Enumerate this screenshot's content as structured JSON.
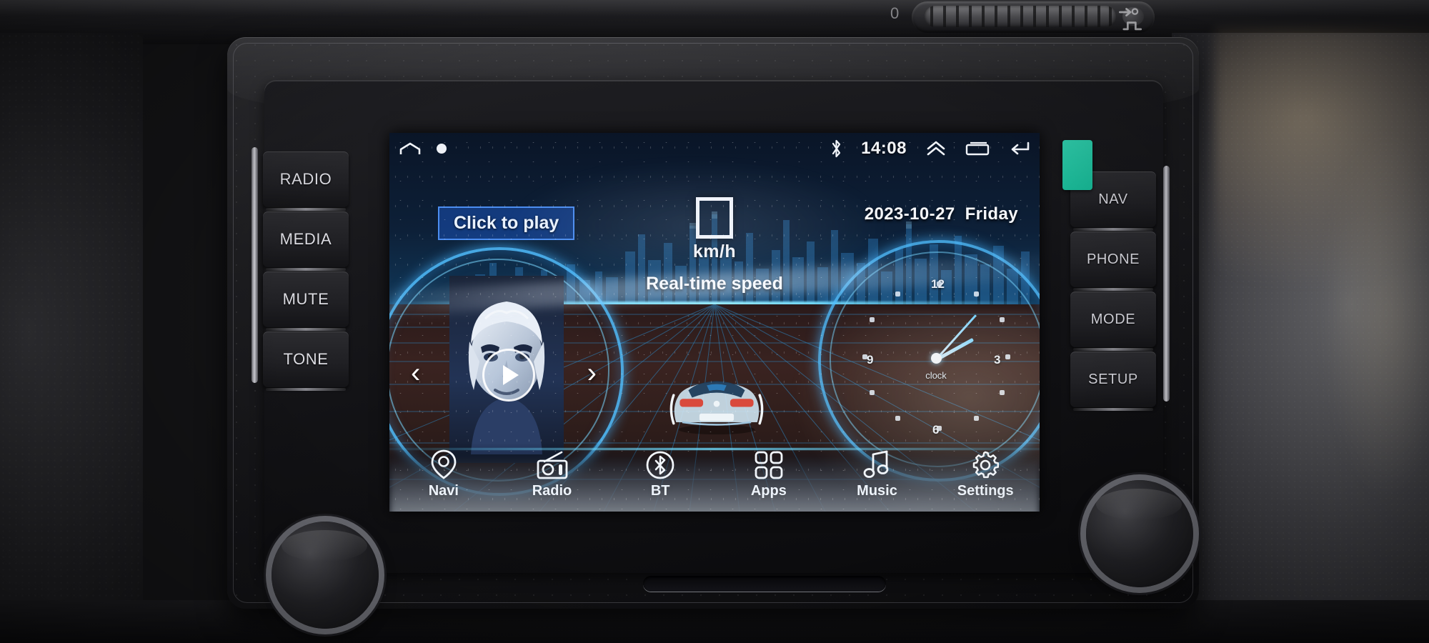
{
  "device": {
    "name": "car-head-unit",
    "brand_context": "Volkswagen RCD-style android car stereo"
  },
  "hard_buttons_left": [
    {
      "label": "RADIO",
      "name": "radio-button"
    },
    {
      "label": "MEDIA",
      "name": "media-button"
    },
    {
      "label": "MUTE",
      "name": "mute-button"
    },
    {
      "label": "TONE",
      "name": "tone-button"
    }
  ],
  "hard_buttons_right": [
    {
      "label": "NAV",
      "name": "nav-button"
    },
    {
      "label": "PHONE",
      "name": "phone-button"
    },
    {
      "label": "MODE",
      "name": "mode-button"
    },
    {
      "label": "SETUP",
      "name": "setup-button"
    }
  ],
  "status_bar": {
    "home_icon": "home-icon",
    "indicator_dot": "recording-dot-icon",
    "bluetooth_icon": "bluetooth-icon",
    "time": "14:08",
    "expand_icon": "double-chevron-up-icon",
    "recents_icon": "recents-square-icon",
    "back_icon": "back-arrow-icon"
  },
  "media_widget": {
    "play_prompt": "Click to play",
    "play_icon": "play-triangle-icon",
    "prev_icon": "chevron-left-icon",
    "next_icon": "chevron-right-icon",
    "album_art": "anime-character-album-art"
  },
  "speed_widget": {
    "value": "",
    "unit": "km/h",
    "label": "Real-time speed",
    "box_icon": "speed-value-placeholder"
  },
  "date_widget": {
    "date": "2023-10-27",
    "weekday": "Friday"
  },
  "clock_widget": {
    "label": "clock",
    "numerals": [
      "12",
      "3",
      "6",
      "9"
    ],
    "hour_angle_deg": 61,
    "minute_angle_deg": 48
  },
  "dock": [
    {
      "label": "Navi",
      "icon": "location-pin-icon",
      "name": "dock-item-navi"
    },
    {
      "label": "Radio",
      "icon": "radio-icon",
      "name": "dock-item-radio"
    },
    {
      "label": "BT",
      "icon": "bluetooth-circle-icon",
      "name": "dock-item-bt"
    },
    {
      "label": "Apps",
      "icon": "grid-apps-icon",
      "name": "dock-item-apps"
    },
    {
      "label": "Music",
      "icon": "music-note-icon",
      "name": "dock-item-music"
    },
    {
      "label": "Settings",
      "icon": "gear-icon",
      "name": "dock-item-settings"
    }
  ],
  "wallpaper": {
    "car": "blue-sports-car-rear-view",
    "scene": "night-city-skyline-with-perspective-road-grid"
  },
  "colors": {
    "accent_blue": "#50beff",
    "button_blue": "#4b8df0",
    "button_fill": "#184caa",
    "sticker_teal": "#2ec9a8",
    "text_white": "#f2f6fb"
  }
}
